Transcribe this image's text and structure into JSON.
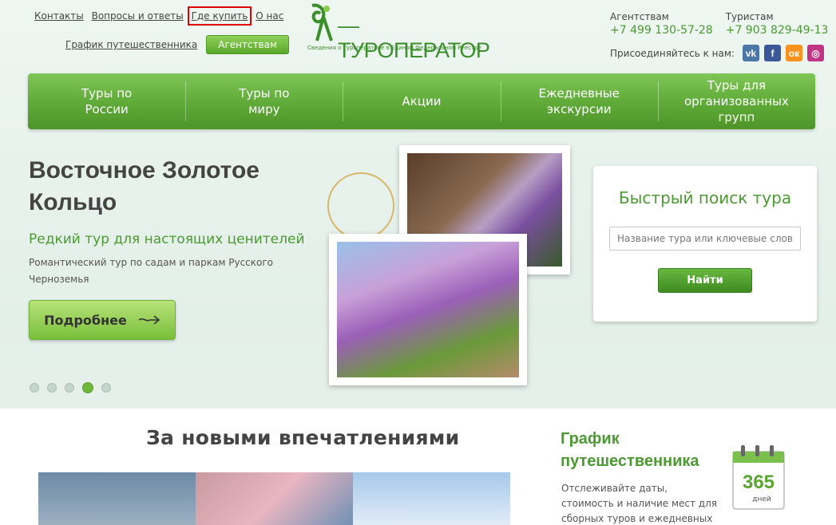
{
  "header": {
    "top_links": [
      "Контакты",
      "Вопросы и ответы",
      "Где купить",
      "О нас"
    ],
    "schedule_link": "График путешественника",
    "agency_button": "Агентствам",
    "logo_text": "—ТУРОПЕРАТОР",
    "logo_subtitle": "Сведения о Туроператоре в Едином Федеральном Реестре",
    "contacts": {
      "agencies_label": "Агентствам",
      "agencies_phone": "+7 499 130-57-28",
      "tourists_label": "Туристам",
      "tourists_phone": "+7 903 829-49-13"
    },
    "social_label": "Присоединяйтесь к нам:",
    "social": [
      {
        "name": "vk-icon",
        "glyph": "vk",
        "color": "#4a76a8"
      },
      {
        "name": "facebook-icon",
        "glyph": "f",
        "color": "#3b5998"
      },
      {
        "name": "odnoklassniki-icon",
        "glyph": "ок",
        "color": "#f7931e"
      },
      {
        "name": "instagram-icon",
        "glyph": "◎",
        "color": "#c13584"
      }
    ]
  },
  "nav": {
    "items": [
      {
        "line1": "Туры по",
        "line2": "России"
      },
      {
        "line1": "Туры по",
        "line2": "миру"
      },
      {
        "line1": "Акции",
        "line2": ""
      },
      {
        "line1": "Ежедневные",
        "line2": "экскурсии"
      },
      {
        "line1": "Туры для",
        "line2": "организованных групп"
      }
    ]
  },
  "hero": {
    "title": "Восточное Золотое Кольцо",
    "subtitle": "Редкий тур для настоящих ценителей",
    "description": "Романтический тур по садам и паркам Русского Черноземья",
    "more_button": "Подробнее",
    "slides_total": 5,
    "active_slide": 4
  },
  "search": {
    "title": "Быстрый поиск тура",
    "placeholder": "Название тура или ключевые слова",
    "button": "Найти"
  },
  "bottom": {
    "section_title": "За новыми впечатлениями",
    "planner_title_line1": "График",
    "planner_title_line2": "путешественника",
    "planner_desc": "Отслеживайте даты, стоимость и наличие мест для сборных туров и ежедневных экскурсий.",
    "calendar_number": "365",
    "calendar_unit": "дней"
  },
  "colors": {
    "brand_green": "#4b9a32",
    "nav_green": "#5ea937",
    "highlight": "#e00000"
  }
}
